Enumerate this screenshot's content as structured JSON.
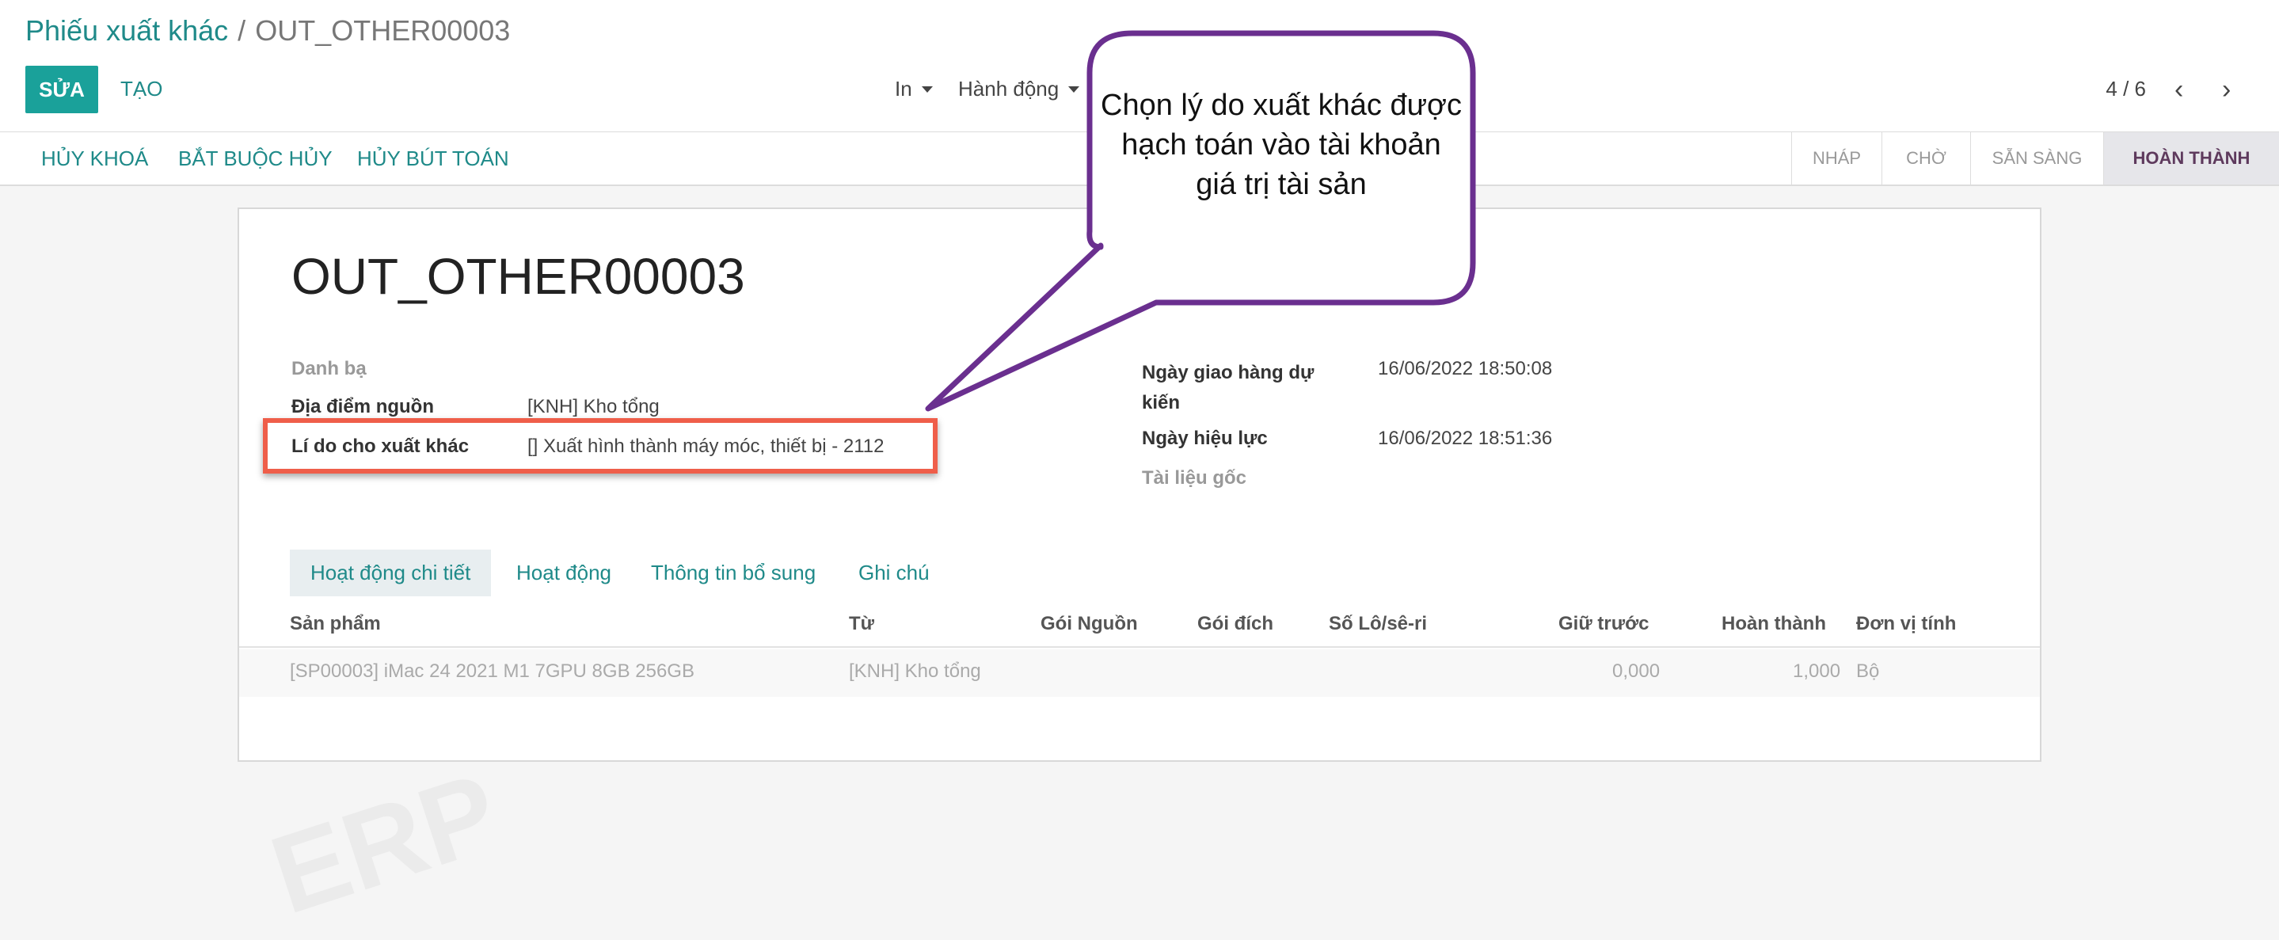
{
  "header": {
    "breadcrumb_parent": "Phiếu xuất khác",
    "breadcrumb_separator": "/",
    "breadcrumb_current": "OUT_OTHER00003",
    "edit_label": "SỬA",
    "create_label": "TẠO",
    "print_label": "In",
    "action_label": "Hành động",
    "pager": "4 / 6"
  },
  "actionbar": {
    "actions": [
      "HỦY KHOÁ",
      "BẮT BUỘC HỦY",
      "HỦY BÚT TOÁN"
    ],
    "statuses": [
      "NHÁP",
      "CHỜ",
      "SẴN SÀNG",
      "HOÀN THÀNH"
    ],
    "active_status": "HOÀN THÀNH"
  },
  "form": {
    "title": "OUT_OTHER00003",
    "left_fields": [
      {
        "label": "Danh bạ",
        "value": ""
      },
      {
        "label": "Địa điểm nguồn",
        "value": "[KNH] Kho tổng"
      },
      {
        "label": "Lí do cho xuất khác",
        "value": "[] Xuất hình thành máy móc, thiết bị - 2112"
      }
    ],
    "right_fields": [
      {
        "label": "Ngày giao hàng dự kiến",
        "value": "16/06/2022 18:50:08"
      },
      {
        "label": "Ngày hiệu lực",
        "value": "16/06/2022 18:51:36"
      },
      {
        "label": "Tài liệu gốc",
        "value": ""
      }
    ],
    "tabs": [
      "Hoạt động chi tiết",
      "Hoạt động",
      "Thông tin bổ sung",
      "Ghi chú"
    ],
    "table": {
      "columns": [
        "Sản phẩm",
        "Từ",
        "Gói Nguồn",
        "Gói đích",
        "Số Lô/sê-ri",
        "Giữ trước",
        "Hoàn thành",
        "Đơn vị tính"
      ],
      "rows": [
        [
          "[SP00003] iMac 24 2021 M1 7GPU 8GB 256GB",
          "[KNH] Kho tổng",
          "",
          "",
          "",
          "0,000",
          "1,000",
          "Bộ"
        ]
      ]
    }
  },
  "callout": {
    "text": "Chọn lý do xuất khác được hạch toán vào tài khoản giá trị tài sản",
    "border_color": "#6a2f8f"
  },
  "colors": {
    "accent": "#1aa19a",
    "link": "#1f8a89",
    "highlight_border": "#ef5e4a"
  }
}
